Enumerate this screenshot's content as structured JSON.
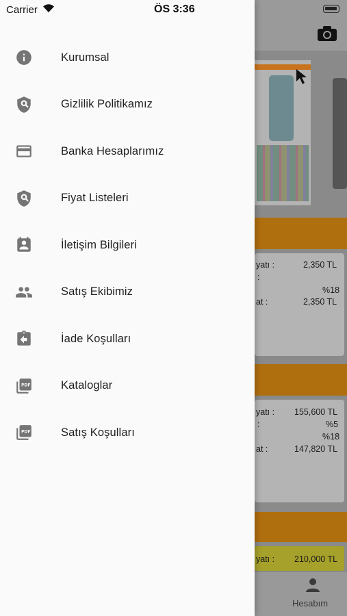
{
  "status_bar": {
    "carrier": "Carrier",
    "time": "ÖS 3:36"
  },
  "drawer": {
    "items": [
      {
        "label": "Kurumsal",
        "icon": "info-icon"
      },
      {
        "label": "Gizlilik Politikamız",
        "icon": "shield-search-icon"
      },
      {
        "label": "Banka Hesaplarımız",
        "icon": "credit-card-icon"
      },
      {
        "label": "Fiyat Listeleri",
        "icon": "shield-search-icon"
      },
      {
        "label": "İletişim Bilgileri",
        "icon": "contact-card-icon"
      },
      {
        "label": "Satış Ekibimiz",
        "icon": "people-icon"
      },
      {
        "label": "İade Koşulları",
        "icon": "clipboard-return-icon"
      },
      {
        "label": "Kataloglar",
        "icon": "pdf-icon"
      },
      {
        "label": "Satış Koşulları",
        "icon": "pdf-icon"
      }
    ]
  },
  "background": {
    "card1": {
      "row1_label": "yatı :",
      "row1_value": "2,350 TL",
      "row2_label": ":",
      "row3_value": "%18",
      "row4_label": "at :",
      "row4_value": "2,350 TL"
    },
    "card2": {
      "row1_label": "yatı :",
      "row1_value": "155,600 TL",
      "row2_label": ":",
      "row2_value": "%5",
      "row3_value": "%18",
      "row4_label": "at :",
      "row4_value": "147,820 TL"
    },
    "card3": {
      "row1_label": "yatı :",
      "row1_value": "210,000 TL"
    },
    "tab_label": "Hesabım",
    "colors": {
      "accent": "#f5a021",
      "dim_overlay": "#8a8a8a"
    }
  }
}
